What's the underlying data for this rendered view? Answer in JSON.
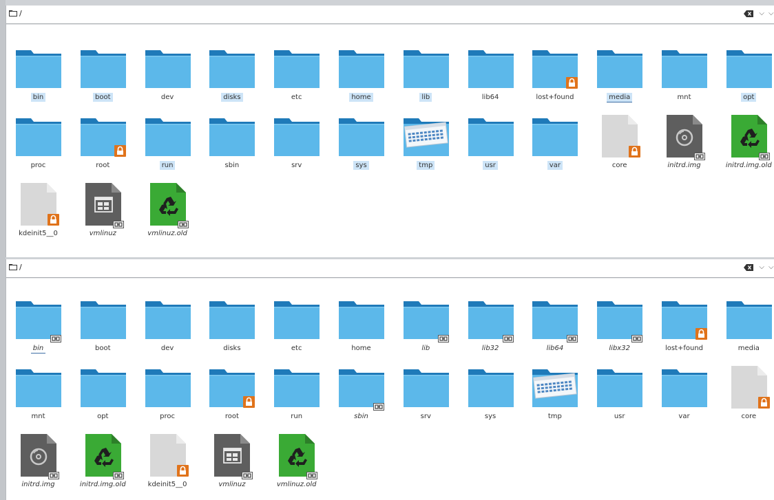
{
  "top": {
    "path": "/",
    "items": [
      {
        "name": "bin",
        "type": "folder",
        "selected": true
      },
      {
        "name": "boot",
        "type": "folder",
        "selected": true
      },
      {
        "name": "dev",
        "type": "folder"
      },
      {
        "name": "disks",
        "type": "folder",
        "selected": true
      },
      {
        "name": "etc",
        "type": "folder"
      },
      {
        "name": "home",
        "type": "folder",
        "selected": true
      },
      {
        "name": "lib",
        "type": "folder",
        "selected": true
      },
      {
        "name": "lib64",
        "type": "folder"
      },
      {
        "name": "lost+found",
        "type": "folder",
        "lock": true
      },
      {
        "name": "media",
        "type": "folder",
        "selected": true,
        "underline": true
      },
      {
        "name": "mnt",
        "type": "folder"
      },
      {
        "name": "opt",
        "type": "folder",
        "selected": true
      },
      {
        "name": "proc",
        "type": "folder"
      },
      {
        "name": "root",
        "type": "folder",
        "lock": true
      },
      {
        "name": "run",
        "type": "folder",
        "selected": true
      },
      {
        "name": "sbin",
        "type": "folder"
      },
      {
        "name": "srv",
        "type": "folder"
      },
      {
        "name": "sys",
        "type": "folder",
        "selected": true
      },
      {
        "name": "tmp",
        "type": "tmpfolder",
        "selected": true
      },
      {
        "name": "usr",
        "type": "folder",
        "selected": true
      },
      {
        "name": "var",
        "type": "folder",
        "selected": true
      },
      {
        "name": "core",
        "type": "file",
        "lock": true
      },
      {
        "name": "initrd.img",
        "type": "disc",
        "link": true,
        "italic": true
      },
      {
        "name": "initrd.img.old",
        "type": "recycle",
        "link": true,
        "italic": true
      },
      {
        "name": "kdeinit5__0",
        "type": "file",
        "lock": true
      },
      {
        "name": "vmlinuz",
        "type": "app",
        "link": true,
        "italic": true
      },
      {
        "name": "vmlinuz.old",
        "type": "recycle",
        "link": true,
        "italic": true
      }
    ]
  },
  "bottom": {
    "path": "/",
    "items": [
      {
        "name": "bin",
        "type": "folder",
        "link": true,
        "italic": true,
        "underline": true
      },
      {
        "name": "boot",
        "type": "folder"
      },
      {
        "name": "dev",
        "type": "folder"
      },
      {
        "name": "disks",
        "type": "folder"
      },
      {
        "name": "etc",
        "type": "folder"
      },
      {
        "name": "home",
        "type": "folder"
      },
      {
        "name": "lib",
        "type": "folder",
        "link": true,
        "italic": true
      },
      {
        "name": "lib32",
        "type": "folder",
        "link": true,
        "italic": true
      },
      {
        "name": "lib64",
        "type": "folder",
        "link": true,
        "italic": true
      },
      {
        "name": "libx32",
        "type": "folder",
        "link": true,
        "italic": true
      },
      {
        "name": "lost+found",
        "type": "folder",
        "lock": true
      },
      {
        "name": "media",
        "type": "folder"
      },
      {
        "name": "mnt",
        "type": "folder"
      },
      {
        "name": "opt",
        "type": "folder"
      },
      {
        "name": "proc",
        "type": "folder"
      },
      {
        "name": "root",
        "type": "folder",
        "lock": true
      },
      {
        "name": "run",
        "type": "folder"
      },
      {
        "name": "sbin",
        "type": "folder",
        "link": true,
        "italic": true
      },
      {
        "name": "srv",
        "type": "folder"
      },
      {
        "name": "sys",
        "type": "folder"
      },
      {
        "name": "tmp",
        "type": "tmpfolder"
      },
      {
        "name": "usr",
        "type": "folder"
      },
      {
        "name": "var",
        "type": "folder"
      },
      {
        "name": "core",
        "type": "file",
        "lock": true
      },
      {
        "name": "initrd.img",
        "type": "disc",
        "link": true,
        "italic": true
      },
      {
        "name": "initrd.img.old",
        "type": "recycle",
        "link": true,
        "italic": true
      },
      {
        "name": "kdeinit5__0",
        "type": "file",
        "lock": true
      },
      {
        "name": "vmlinuz",
        "type": "app",
        "link": true,
        "italic": true
      },
      {
        "name": "vmlinuz.old",
        "type": "recycle",
        "link": true,
        "italic": true
      }
    ]
  },
  "colors": {
    "folder_body": "#5cb8ea",
    "folder_tab": "#1f7ab9",
    "lock_badge": "#e0731b",
    "recycle_green": "#3aaa35",
    "selection": "#cde4f7"
  }
}
